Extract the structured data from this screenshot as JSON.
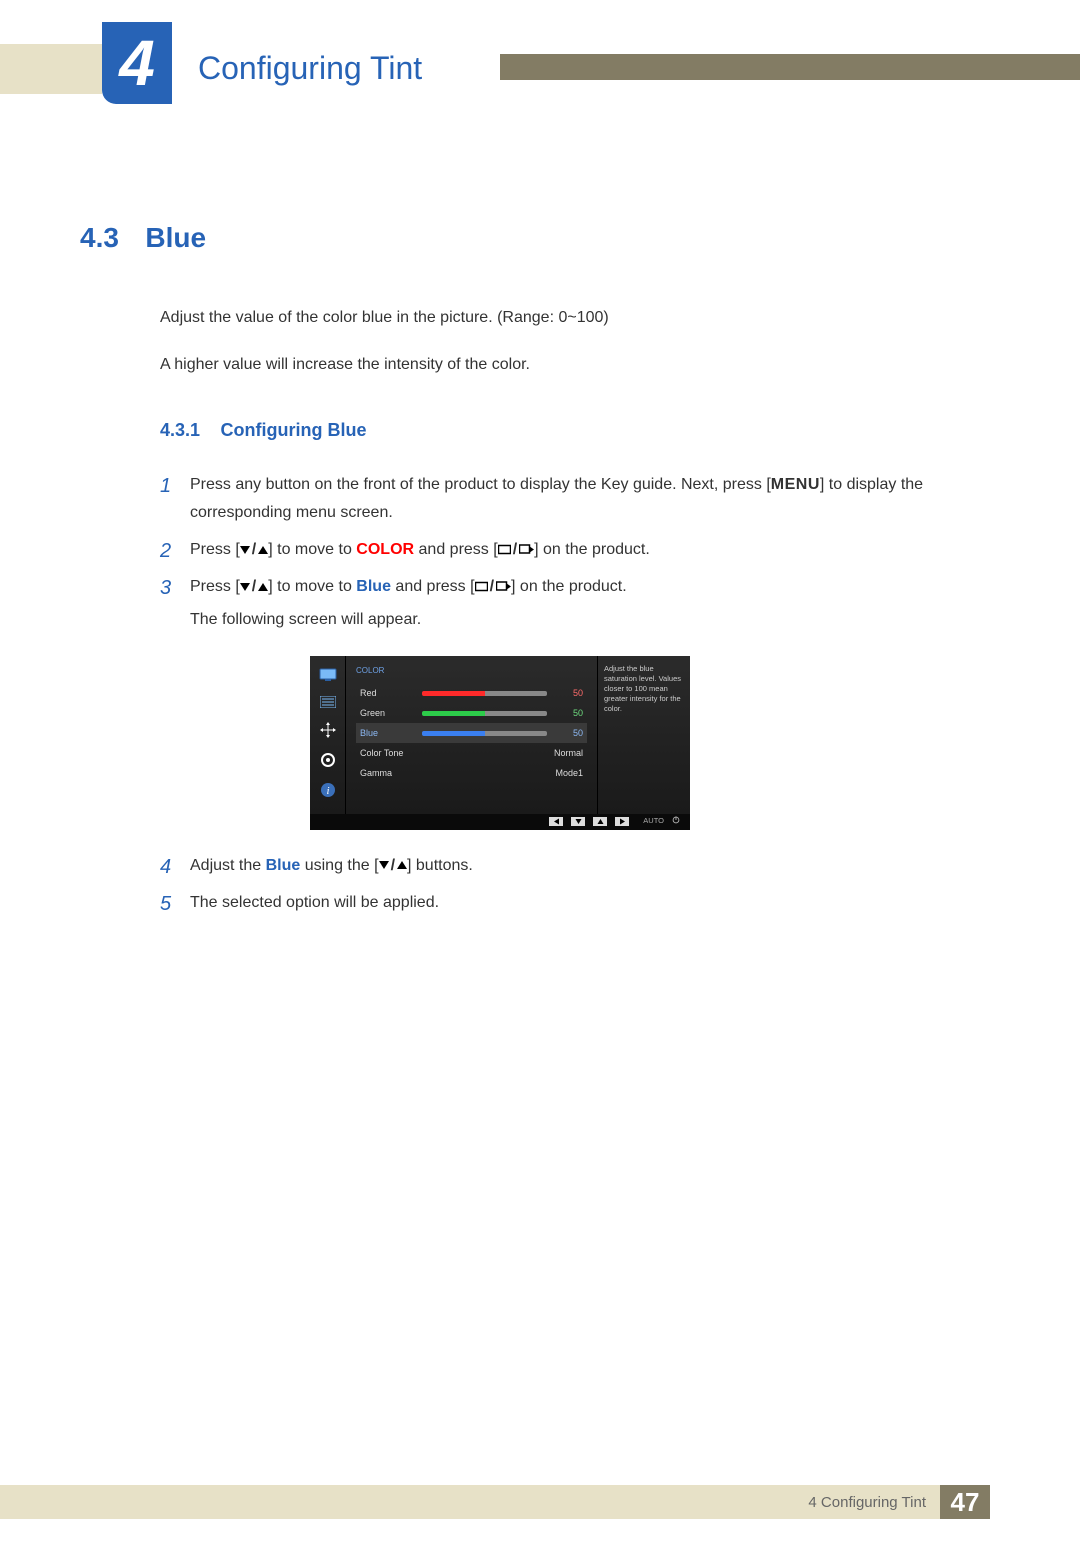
{
  "chapter": {
    "number": "4",
    "title": "Configuring Tint"
  },
  "section": {
    "number": "4.3",
    "title": "Blue",
    "intro1": "Adjust the value of the color blue in the picture. (Range: 0~100)",
    "intro2": "A higher value will increase the intensity of the color."
  },
  "subsection": {
    "number": "4.3.1",
    "title": "Configuring Blue"
  },
  "steps": {
    "s1a": "Press any button on the front of the product to display the Key guide. Next, press [",
    "s1_menu": "MENU",
    "s1b": "] to display the corresponding menu screen.",
    "s2a": "Press [",
    "s2b": "] to move to ",
    "s2_color": "COLOR",
    "s2c": " and press [",
    "s2d": "] on the product.",
    "s3a": "Press [",
    "s3b": "] to move to ",
    "s3_blue": "Blue",
    "s3c": " and press [",
    "s3d": "] on the product.",
    "s3e": "The following screen will appear.",
    "s4a": "Adjust the ",
    "s4_blue": "Blue",
    "s4b": " using the [",
    "s4c": "] buttons.",
    "s5": "The selected option will be applied."
  },
  "osd": {
    "header": "COLOR",
    "rows": {
      "red": {
        "label": "Red",
        "value": "50"
      },
      "green": {
        "label": "Green",
        "value": "50"
      },
      "blue": {
        "label": "Blue",
        "value": "50"
      },
      "colortone": {
        "label": "Color Tone",
        "value": "Normal"
      },
      "gamma": {
        "label": "Gamma",
        "value": "Mode1"
      }
    },
    "help": "Adjust the blue saturation level. Values closer to 100 mean greater intensity for the color.",
    "footer": {
      "auto": "AUTO"
    }
  },
  "chart_data": {
    "type": "bar",
    "title": "COLOR",
    "categories": [
      "Red",
      "Green",
      "Blue"
    ],
    "values": [
      50,
      50,
      50
    ],
    "ylim": [
      0,
      100
    ],
    "xlabel": "",
    "ylabel": ""
  },
  "footer": {
    "label": "4 Configuring Tint",
    "page": "47"
  }
}
